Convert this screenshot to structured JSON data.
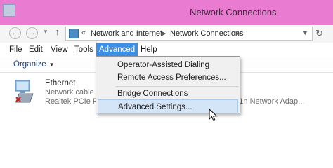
{
  "window": {
    "title": "Network Connections"
  },
  "address": {
    "crumbs": [
      "Network and Internet",
      "Network Connections"
    ],
    "overflow": "«"
  },
  "menubar": {
    "items": [
      "File",
      "Edit",
      "View",
      "Tools",
      "Advanced",
      "Help"
    ],
    "active": "Advanced"
  },
  "commandbar": {
    "organize": "Organize"
  },
  "adapters": [
    {
      "name": "Ethernet",
      "status": "Network cable u",
      "device": "Realtek PCIe FE F"
    },
    {
      "device": "11n Network Adap..."
    }
  ],
  "advanced_menu": {
    "items": [
      "Operator-Assisted Dialing",
      "Remote Access Preferences...",
      "Bridge Connections",
      "Advanced Settings..."
    ],
    "highlighted": "Advanced Settings..."
  },
  "colors": {
    "titlebar": "#e97bd1",
    "menu_active": "#3d8ee5",
    "menu_highlight": "#d5e5f8"
  }
}
